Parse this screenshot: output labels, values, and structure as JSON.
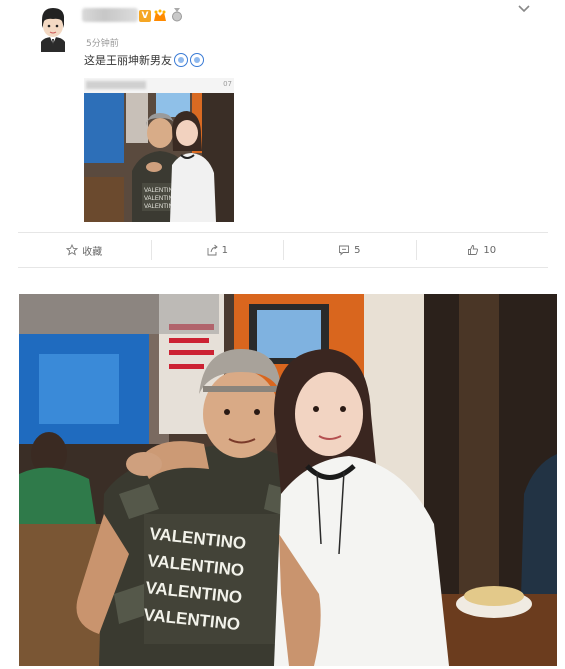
{
  "post": {
    "time": "5分钟前",
    "text": "这是王丽坤新男友",
    "badge_v": "V",
    "thumb_number": "07"
  },
  "actions": [
    {
      "icon": "star-icon",
      "label": "收藏"
    },
    {
      "icon": "share-icon",
      "label": "1"
    },
    {
      "icon": "comment-icon",
      "label": "5"
    },
    {
      "icon": "like-icon",
      "label": "10"
    }
  ],
  "shirt_print": "VALENTINO",
  "colors": {
    "text": "#333333",
    "muted": "#999999",
    "divider": "#e6e6e6",
    "badge": "#f5a623"
  }
}
